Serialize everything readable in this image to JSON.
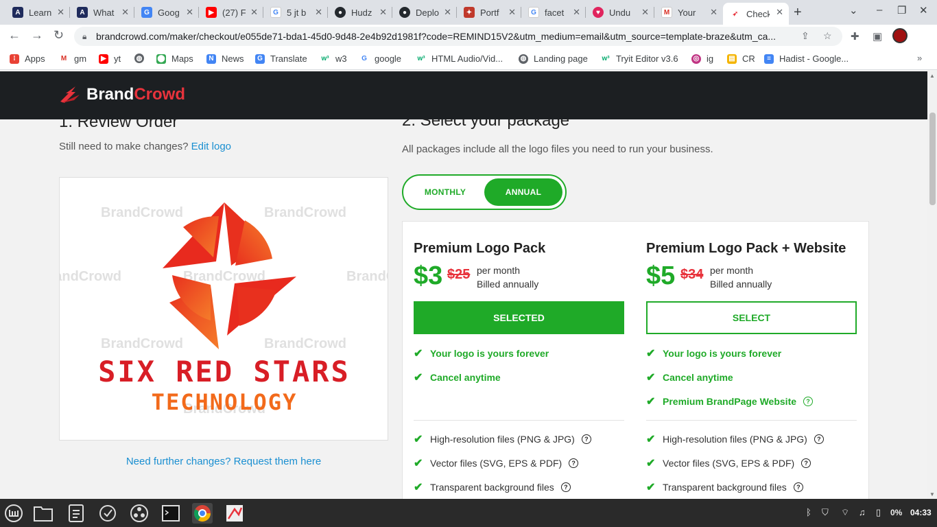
{
  "browser": {
    "tabs": [
      {
        "title": "Learn",
        "icon": "app-icon",
        "color": "#1f2b5c"
      },
      {
        "title": "What",
        "icon": "app-icon",
        "color": "#1f2b5c"
      },
      {
        "title": "Goog",
        "icon": "translate-icon",
        "color": "#4285f4"
      },
      {
        "title": "(27) F",
        "icon": "youtube-icon",
        "color": "#ff0000"
      },
      {
        "title": "5 jt b",
        "icon": "google-icon",
        "color": "#4285f4"
      },
      {
        "title": "Hudz",
        "icon": "github-icon",
        "color": "#24292e"
      },
      {
        "title": "Deplo",
        "icon": "github-icon",
        "color": "#24292e"
      },
      {
        "title": "Portf",
        "icon": "app-icon",
        "color": "#c0392b"
      },
      {
        "title": "facet",
        "icon": "google-icon",
        "color": "#4285f4"
      },
      {
        "title": "Undu",
        "icon": "heart-icon",
        "color": "#e0245e"
      },
      {
        "title": "Your",
        "icon": "gmail-icon",
        "color": "#d93025"
      },
      {
        "title": "Check",
        "icon": "brandcrowd-icon",
        "color": "#e8333c"
      }
    ],
    "url": "brandcrowd.com/maker/checkout/e055de71-bda1-45d0-9d48-2e4b92d1981f?code=REMIND15V2&utm_medium=email&utm_source=template-braze&utm_ca...",
    "bookmarks": [
      {
        "label": "Apps",
        "icon": "apps-icon",
        "color": "#e94235"
      },
      {
        "label": "gm",
        "icon": "gmail-icon",
        "color": "#d93025"
      },
      {
        "label": "yt",
        "icon": "youtube-icon",
        "color": "#ff0000"
      },
      {
        "label": "",
        "icon": "globe-icon",
        "color": "#5f6368"
      },
      {
        "label": "Maps",
        "icon": "maps-icon",
        "color": "#34a853"
      },
      {
        "label": "News",
        "icon": "news-icon",
        "color": "#4285f4"
      },
      {
        "label": "Translate",
        "icon": "translate-icon",
        "color": "#4285f4"
      },
      {
        "label": "w3",
        "icon": "w3-icon",
        "color": "#04aa6d"
      },
      {
        "label": "google",
        "icon": "google-icon",
        "color": "#4285f4"
      },
      {
        "label": "HTML Audio/Vid...",
        "icon": "w3-icon",
        "color": "#04aa6d"
      },
      {
        "label": "Landing page",
        "icon": "globe-icon",
        "color": "#5f6368"
      },
      {
        "label": "Tryit Editor v3.6",
        "icon": "w3-icon",
        "color": "#04aa6d"
      },
      {
        "label": "ig",
        "icon": "instagram-icon",
        "color": "#c13584"
      },
      {
        "label": "CR",
        "icon": "classroom-icon",
        "color": "#f4b400"
      },
      {
        "label": "Hadist - Google...",
        "icon": "docs-icon",
        "color": "#4285f4"
      }
    ]
  },
  "site": {
    "brand_first": "Brand",
    "brand_second": "Crowd"
  },
  "review": {
    "title": "1. Review Order",
    "still_text": "Still need to make changes?",
    "edit_link": "Edit logo",
    "logo_line1": "SIX RED STARS",
    "logo_line2": "TECHNOLOGY",
    "watermark": "BrandCrowd",
    "further_link": "Need further changes? Request them here"
  },
  "packages": {
    "title": "2. Select your package",
    "subtitle": "All packages include all the logo files you need to run your business.",
    "toggle_monthly": "MONTHLY",
    "toggle_annual": "ANNUAL",
    "cards": [
      {
        "name": "Premium Logo Pack",
        "price": "$3",
        "old_price": "$25",
        "per": "per month",
        "billed": "Billed annually",
        "button": "SELECTED",
        "highlights": [
          "Your logo is yours forever",
          "Cancel anytime"
        ],
        "files": [
          "High-resolution files (PNG & JPG)",
          "Vector files (SVG, EPS & PDF)",
          "Transparent background files"
        ]
      },
      {
        "name": "Premium Logo Pack + Website",
        "price": "$5",
        "old_price": "$34",
        "per": "per month",
        "billed": "Billed annually",
        "button": "SELECT",
        "highlights": [
          "Your logo is yours forever",
          "Cancel anytime",
          "Premium BrandPage Website"
        ],
        "files": [
          "High-resolution files (PNG & JPG)",
          "Vector files (SVG, EPS & PDF)",
          "Transparent background files"
        ]
      }
    ]
  },
  "taskbar": {
    "battery": "0%",
    "time": "04:33"
  },
  "colors": {
    "accent_green": "#1faa28",
    "brand_red": "#e8333c",
    "link_blue": "#1a8fd1",
    "header_dark": "#1c1f22"
  }
}
